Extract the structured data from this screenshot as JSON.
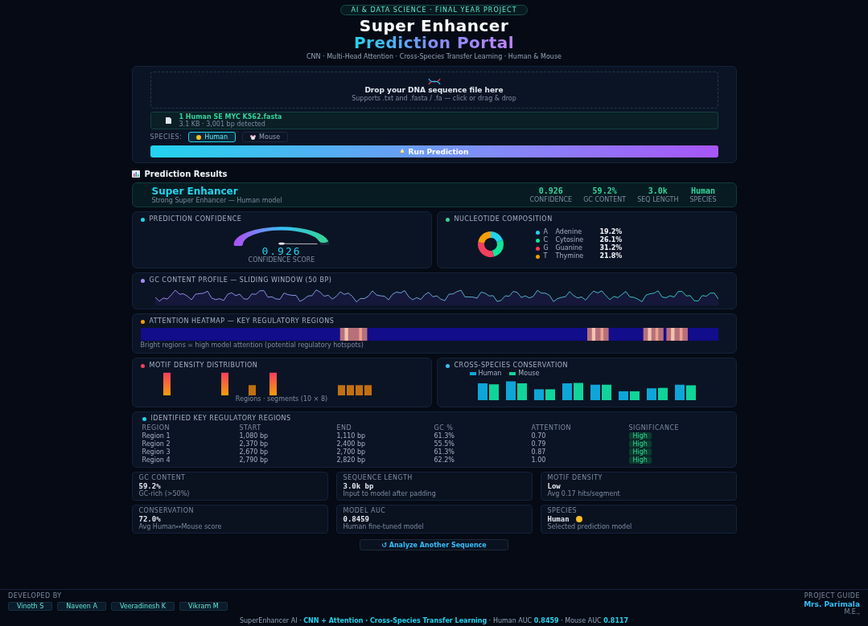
{
  "header": {
    "badge": "AI & DATA SCIENCE · FINAL YEAR PROJECT",
    "title_line_1": "Super Enhancer",
    "title_line_2": "Prediction Portal",
    "subtitle": "CNN · Multi-Head Attention · Cross-Species Transfer Learning · Human & Mouse"
  },
  "upload": {
    "drop_title": "Drop your DNA sequence file here",
    "drop_hint": "Supports .txt and .fasta / .fa — click or drag & drop",
    "file": {
      "name": "1 Human SE MYC K562.fasta",
      "info": "3.1 KB · 3,001 bp detected"
    },
    "species_label": "SPECIES:",
    "species": [
      {
        "label": "Human",
        "kind": "human",
        "selected": true
      },
      {
        "label": "Mouse",
        "kind": "mouse",
        "selected": false
      }
    ],
    "run_button": "Run Prediction"
  },
  "results": {
    "heading": "Prediction Results",
    "summary": {
      "title": "Super Enhancer",
      "subtitle": "Strong Super Enhancer — Human model",
      "metrics": [
        {
          "value": "0.926",
          "label": "CONFIDENCE"
        },
        {
          "value": "59.2%",
          "label": "GC CONTENT"
        },
        {
          "value": "3.0k",
          "label": "SEQ LENGTH"
        },
        {
          "value": "Human",
          "label": "SPECIES"
        }
      ]
    },
    "confidence": {
      "title": "PREDICTION CONFIDENCE",
      "value": "0.926",
      "label": "CONFIDENCE SCORE"
    },
    "nucleotides": {
      "title": "NUCLEOTIDE COMPOSITION",
      "items": [
        {
          "letter": "A",
          "name": "Adenine",
          "percent": "19.2%",
          "color": "#22d3ee"
        },
        {
          "letter": "C",
          "name": "Cytosine",
          "percent": "26.1%",
          "color": "#10e69a"
        },
        {
          "letter": "G",
          "name": "Guanine",
          "percent": "31.2%",
          "color": "#f43f5e"
        },
        {
          "letter": "T",
          "name": "Thymine",
          "percent": "21.8%",
          "color": "#f59e0b"
        }
      ]
    },
    "gc_profile": {
      "title": "GC CONTENT PROFILE — SLIDING WINDOW (50 BP)"
    },
    "heatmap": {
      "title": "ATTENTION HEATMAP — KEY REGULATORY REGIONS",
      "caption": "Bright regions = high model attention (potential regulatory hotspots)"
    },
    "motif": {
      "title": "MOTIF DENSITY DISTRIBUTION",
      "caption": "Regions · segments (10 × 8)"
    },
    "conservation": {
      "title": "CROSS-SPECIES CONSERVATION",
      "legend": [
        {
          "label": "Human",
          "color": "#0ea5d9"
        },
        {
          "label": "Mouse",
          "color": "#10d49a"
        }
      ]
    },
    "regions": {
      "title": "IDENTIFIED KEY REGULATORY REGIONS",
      "columns": [
        "REGION",
        "START",
        "END",
        "GC %",
        "ATTENTION",
        "SIGNIFICANCE"
      ],
      "rows": [
        {
          "cells": [
            "Region 1",
            "1,080 bp",
            "1,110 bp",
            "61.3%",
            "0.70"
          ],
          "significance": "High"
        },
        {
          "cells": [
            "Region 2",
            "2,370 bp",
            "2,400 bp",
            "55.5%",
            "0.79"
          ],
          "significance": "High"
        },
        {
          "cells": [
            "Region 3",
            "2,670 bp",
            "2,700 bp",
            "61.3%",
            "0.87"
          ],
          "significance": "High"
        },
        {
          "cells": [
            "Region 4",
            "2,790 bp",
            "2,820 bp",
            "62.2%",
            "1.00"
          ],
          "significance": "High"
        }
      ]
    },
    "stats": [
      {
        "label": "GC CONTENT",
        "value": "59.2%",
        "note": "GC-rich (>50%)"
      },
      {
        "label": "SEQUENCE LENGTH",
        "value": "3.0k bp",
        "note": "Input to model after padding"
      },
      {
        "label": "MOTIF DENSITY",
        "value": "Low",
        "note": "Avg 0.17 hits/segment"
      },
      {
        "label": "CONSERVATION",
        "value": "72.0%",
        "note": "Avg Human↔Mouse score"
      },
      {
        "label": "MODEL AUC",
        "value": "0.8459",
        "note": "Human fine-tuned model"
      },
      {
        "label": "SPECIES",
        "value": "Human",
        "kind": "species",
        "note": "Selected prediction model"
      }
    ],
    "analyze_button": "↺ Analyze Another Sequence"
  },
  "footer": {
    "developed_label": "DEVELOPED BY",
    "developers": [
      "Vinoth S",
      "Naveen A",
      "Veeradinesh K",
      "Vikram M"
    ],
    "guide_label": "PROJECT GUIDE",
    "guide_name": "Mrs. Parimala",
    "guide_title": "M.E.,",
    "credits": "SuperEnhancer AI · **CNN + Attention · Cross-Species Transfer Learning** · Human AUC **0.8459** · Mouse AUC **0.8117**"
  }
}
